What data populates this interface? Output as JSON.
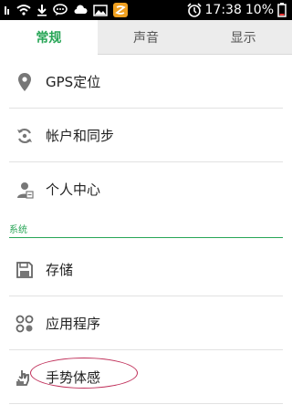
{
  "status_bar": {
    "time": "17:38",
    "battery": "10%"
  },
  "tabs": [
    {
      "label": "常规",
      "active": true
    },
    {
      "label": "声音",
      "active": false
    },
    {
      "label": "显示",
      "active": false
    }
  ],
  "items": [
    {
      "label": "GPS定位",
      "icon": "location-pin-icon"
    },
    {
      "label": "帐户和同步",
      "icon": "sync-icon"
    },
    {
      "label": "个人中心",
      "icon": "user-icon"
    }
  ],
  "section": {
    "label": "系统"
  },
  "system_items": [
    {
      "label": "存储",
      "icon": "save-disk-icon"
    },
    {
      "label": "应用程序",
      "icon": "apps-icon"
    },
    {
      "label": "手势体感",
      "icon": "gesture-icon"
    }
  ],
  "colors": {
    "accent": "#27a556",
    "highlight_oval": "#c0305a"
  }
}
